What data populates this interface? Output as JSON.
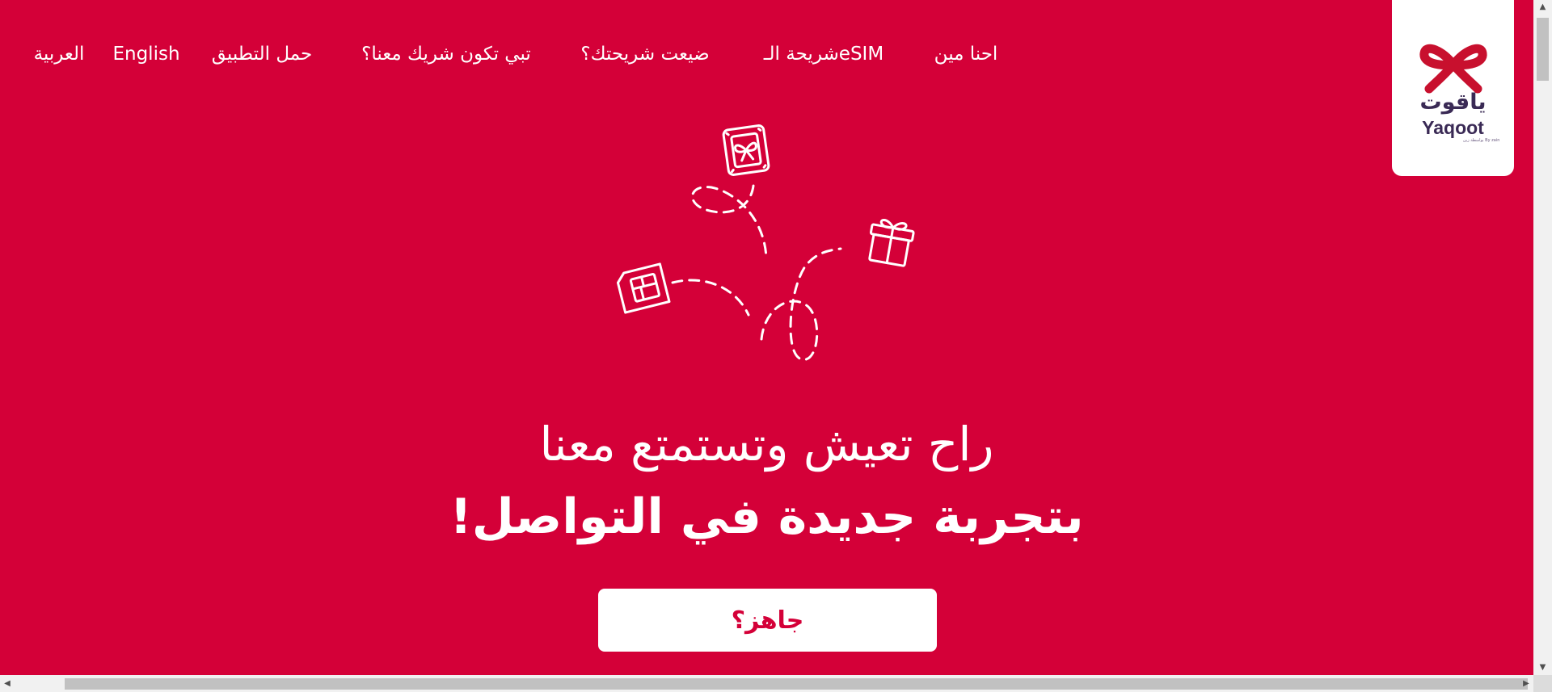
{
  "nav": {
    "about": "احنا مين",
    "esim": "شريحة الـeSIM",
    "lost_sim": "ضيعت شريحتك؟",
    "partner": "تبي تكون شريك معنا؟",
    "download_app": "حمل التطبيق",
    "english": "English",
    "arabic": "العربية"
  },
  "logo": {
    "arabic": "ياقوت",
    "english": "Yaqoot",
    "tagline": "بواسطة زين By zain",
    "color": "#c8102e"
  },
  "hero": {
    "line1": "راح تعيش وتستمتع معنا",
    "line2": "بتجربة جديدة في التواصل!",
    "cta": "جاهز؟"
  },
  "colors": {
    "background": "#d40038",
    "card": "#ffffff",
    "logo_text": "#3a2a55"
  },
  "icons": [
    "sim-card-icon",
    "esim-icon",
    "gift-icon",
    "bow-logo-icon"
  ]
}
